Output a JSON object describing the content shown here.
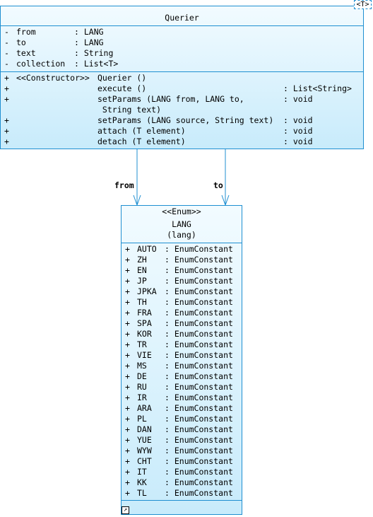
{
  "querier": {
    "template_param": "T",
    "name": "Querier",
    "attributes": [
      {
        "vis": "-",
        "name": "from",
        "type": ": LANG"
      },
      {
        "vis": "-",
        "name": "to",
        "type": ": LANG"
      },
      {
        "vis": "-",
        "name": "text",
        "type": ": String"
      },
      {
        "vis": "-",
        "name": "collection",
        "type": ": List<T>"
      }
    ],
    "operations": [
      {
        "vis": "+",
        "stereo": "<<Constructor>>",
        "sig": "Querier ()",
        "ret": ""
      },
      {
        "vis": "+",
        "stereo": "",
        "sig": "execute ()",
        "ret": ": List<String>"
      },
      {
        "vis": "+",
        "stereo": "",
        "sig": "setParams (LANG from, LANG to,",
        "ret": ": void"
      },
      {
        "vis": "",
        "stereo": "",
        "sig": " String text)",
        "ret": ""
      },
      {
        "vis": "+",
        "stereo": "",
        "sig": "setParams (LANG source, String text)",
        "ret": ": void"
      },
      {
        "vis": "+",
        "stereo": "",
        "sig": "attach (T element)",
        "ret": ": void"
      },
      {
        "vis": "+",
        "stereo": "",
        "sig": "detach (T element)",
        "ret": ": void"
      }
    ]
  },
  "associations": {
    "from_label": "from",
    "to_label": "to"
  },
  "lang": {
    "stereotype": "<<Enum>>",
    "name": "LANG",
    "alias": "(lang)",
    "constants": [
      {
        "vis": "+",
        "name": "AUTO",
        "type": ": EnumConstant"
      },
      {
        "vis": "+",
        "name": "ZH",
        "type": ": EnumConstant"
      },
      {
        "vis": "+",
        "name": "EN",
        "type": ": EnumConstant"
      },
      {
        "vis": "+",
        "name": "JP",
        "type": ": EnumConstant"
      },
      {
        "vis": "+",
        "name": "JPKA",
        "type": ": EnumConstant"
      },
      {
        "vis": "+",
        "name": "TH",
        "type": ": EnumConstant"
      },
      {
        "vis": "+",
        "name": "FRA",
        "type": ": EnumConstant"
      },
      {
        "vis": "+",
        "name": "SPA",
        "type": ": EnumConstant"
      },
      {
        "vis": "+",
        "name": "KOR",
        "type": ": EnumConstant"
      },
      {
        "vis": "+",
        "name": "TR",
        "type": ": EnumConstant"
      },
      {
        "vis": "+",
        "name": "VIE",
        "type": ": EnumConstant"
      },
      {
        "vis": "+",
        "name": "MS",
        "type": ": EnumConstant"
      },
      {
        "vis": "+",
        "name": "DE",
        "type": ": EnumConstant"
      },
      {
        "vis": "+",
        "name": "RU",
        "type": ": EnumConstant"
      },
      {
        "vis": "+",
        "name": "IR",
        "type": ": EnumConstant"
      },
      {
        "vis": "+",
        "name": "ARA",
        "type": ": EnumConstant"
      },
      {
        "vis": "+",
        "name": "PL",
        "type": ": EnumConstant"
      },
      {
        "vis": "+",
        "name": "DAN",
        "type": ": EnumConstant"
      },
      {
        "vis": "+",
        "name": "YUE",
        "type": ": EnumConstant"
      },
      {
        "vis": "+",
        "name": "WYW",
        "type": ": EnumConstant"
      },
      {
        "vis": "+",
        "name": "CHT",
        "type": ": EnumConstant"
      },
      {
        "vis": "+",
        "name": "IT",
        "type": ": EnumConstant"
      },
      {
        "vis": "+",
        "name": "KK",
        "type": ": EnumConstant"
      },
      {
        "vis": "+",
        "name": "TL",
        "type": ": EnumConstant"
      }
    ]
  },
  "colors": {
    "border": "#1f8fd1",
    "fill_top": "#f2fbff",
    "fill_bottom": "#c8ebfb"
  },
  "icons": {
    "resize_handle": "diagonal-arrow-icon"
  }
}
